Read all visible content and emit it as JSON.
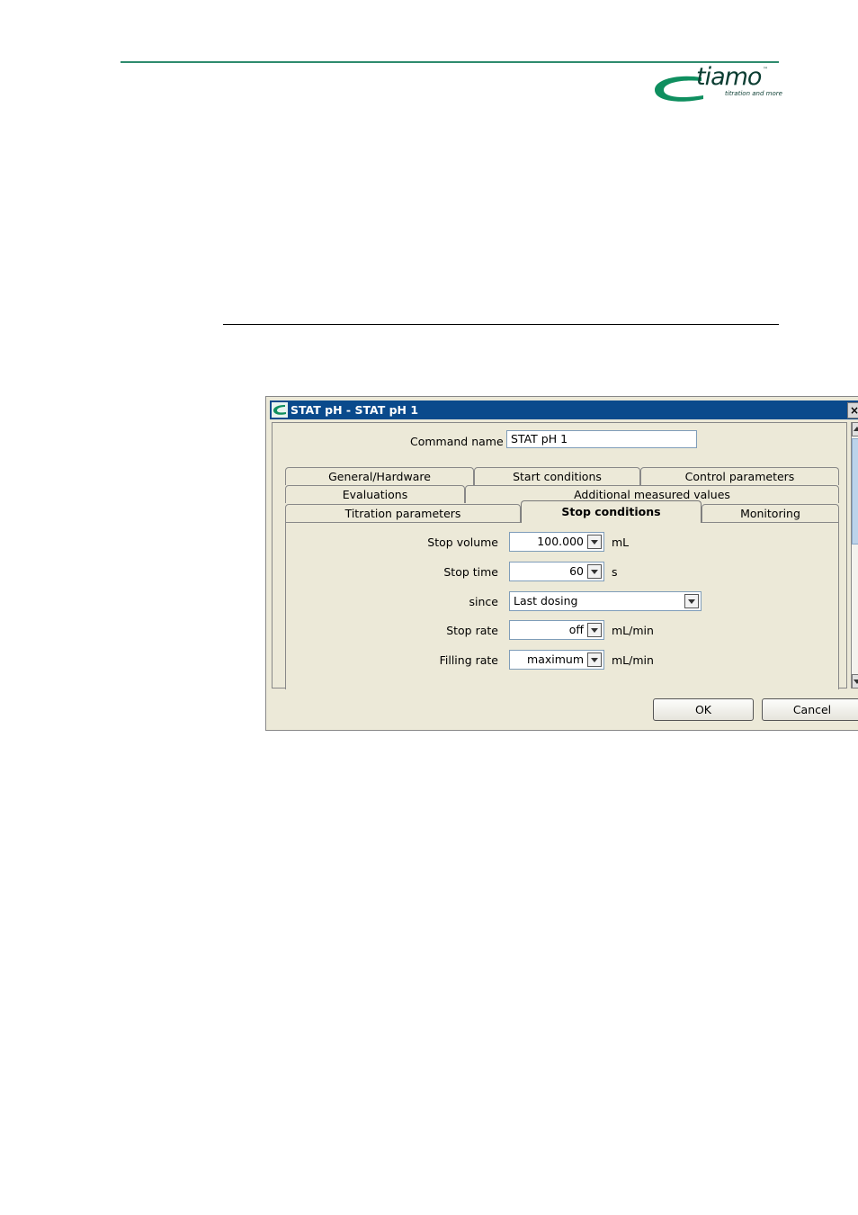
{
  "logo": {
    "brand": "tiamo",
    "tm": "™",
    "tagline": "titration and more"
  },
  "dialog": {
    "title": "STAT pH - STAT pH 1",
    "close_glyph": "×",
    "command_name_label": "Command name",
    "command_name_value": "STAT pH 1",
    "tabs_row1": [
      "General/Hardware",
      "Start conditions",
      "Control parameters"
    ],
    "tabs_row2": [
      "Evaluations",
      "Additional measured values"
    ],
    "tabs_row3": [
      "Titration parameters",
      "Stop conditions",
      "Monitoring"
    ],
    "active_tab": "Stop conditions",
    "fields": {
      "stop_volume": {
        "label": "Stop volume",
        "value": "100.000",
        "unit": "mL"
      },
      "stop_time": {
        "label": "Stop time",
        "value": "60",
        "unit": "s"
      },
      "since": {
        "label": "since",
        "value": "Last dosing"
      },
      "stop_rate": {
        "label": "Stop rate",
        "value": "off",
        "unit": "mL/min"
      },
      "filling_rate": {
        "label": "Filling rate",
        "value": "maximum",
        "unit": "mL/min"
      }
    },
    "ok_label": "OK",
    "cancel_label": "Cancel"
  },
  "colors": {
    "titlebar": "#0a4a8c",
    "rule": "#2e8b6e",
    "dialog_bg": "#ece9d8"
  }
}
